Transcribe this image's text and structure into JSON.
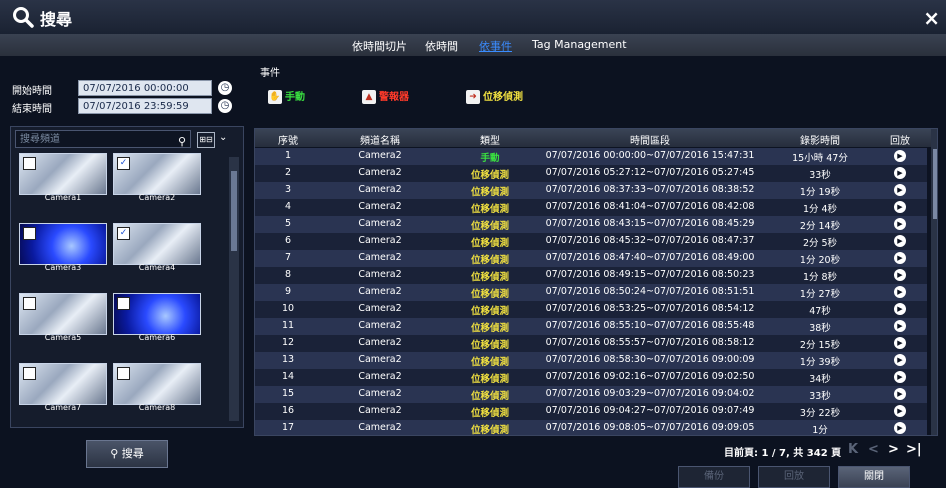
{
  "window": {
    "title": "搜尋",
    "close_glyph": "×"
  },
  "tabs": [
    {
      "label": "依時間切片",
      "active": false
    },
    {
      "label": "依時間",
      "active": false
    },
    {
      "label": "依事件",
      "active": true
    },
    {
      "label": "Tag Management",
      "active": false
    }
  ],
  "time": {
    "start_label": "開始時間",
    "start_value": "07/07/2016 00:00:00",
    "end_label": "結束時間",
    "end_value": "07/07/2016 23:59:59"
  },
  "channels": {
    "search_placeholder": "搜尋頻道",
    "view_toggle": "⊞⊟",
    "items": [
      {
        "name": "Camera1",
        "checked": false,
        "style": "light"
      },
      {
        "name": "Camera2",
        "checked": true,
        "style": "light"
      },
      {
        "name": "Camera3",
        "checked": false,
        "style": "blue"
      },
      {
        "name": "Camera4",
        "checked": true,
        "style": "light"
      },
      {
        "name": "Camera5",
        "checked": false,
        "style": "light"
      },
      {
        "name": "Camera6",
        "checked": false,
        "style": "blue"
      },
      {
        "name": "Camera7",
        "checked": false,
        "style": "light"
      },
      {
        "name": "Camera8",
        "checked": false,
        "style": "light"
      }
    ]
  },
  "search_button": "搜尋",
  "events": {
    "label": "事件",
    "types": [
      {
        "label": "手動",
        "color": "#3ae040"
      },
      {
        "label": "警報器",
        "color": "#ff3a2a"
      },
      {
        "label": "位移偵測",
        "color": "#f0e040"
      }
    ]
  },
  "table": {
    "headers": [
      "序號",
      "頻道名稱",
      "類型",
      "時間區段",
      "錄影時間",
      "回放"
    ],
    "rows": [
      {
        "no": "1",
        "ch": "Camera2",
        "type": "手動",
        "kind": "manual",
        "range": "07/07/2016 00:00:00~07/07/2016 15:47:31",
        "dur": "15小時 47分"
      },
      {
        "no": "2",
        "ch": "Camera2",
        "type": "位移偵測",
        "kind": "motion",
        "range": "07/07/2016 05:27:12~07/07/2016 05:27:45",
        "dur": "33秒"
      },
      {
        "no": "3",
        "ch": "Camera2",
        "type": "位移偵測",
        "kind": "motion",
        "range": "07/07/2016 08:37:33~07/07/2016 08:38:52",
        "dur": "1分 19秒"
      },
      {
        "no": "4",
        "ch": "Camera2",
        "type": "位移偵測",
        "kind": "motion",
        "range": "07/07/2016 08:41:04~07/07/2016 08:42:08",
        "dur": "1分 4秒"
      },
      {
        "no": "5",
        "ch": "Camera2",
        "type": "位移偵測",
        "kind": "motion",
        "range": "07/07/2016 08:43:15~07/07/2016 08:45:29",
        "dur": "2分 14秒"
      },
      {
        "no": "6",
        "ch": "Camera2",
        "type": "位移偵測",
        "kind": "motion",
        "range": "07/07/2016 08:45:32~07/07/2016 08:47:37",
        "dur": "2分 5秒"
      },
      {
        "no": "7",
        "ch": "Camera2",
        "type": "位移偵測",
        "kind": "motion",
        "range": "07/07/2016 08:47:40~07/07/2016 08:49:00",
        "dur": "1分 20秒"
      },
      {
        "no": "8",
        "ch": "Camera2",
        "type": "位移偵測",
        "kind": "motion",
        "range": "07/07/2016 08:49:15~07/07/2016 08:50:23",
        "dur": "1分 8秒"
      },
      {
        "no": "9",
        "ch": "Camera2",
        "type": "位移偵測",
        "kind": "motion",
        "range": "07/07/2016 08:50:24~07/07/2016 08:51:51",
        "dur": "1分 27秒"
      },
      {
        "no": "10",
        "ch": "Camera2",
        "type": "位移偵測",
        "kind": "motion",
        "range": "07/07/2016 08:53:25~07/07/2016 08:54:12",
        "dur": "47秒"
      },
      {
        "no": "11",
        "ch": "Camera2",
        "type": "位移偵測",
        "kind": "motion",
        "range": "07/07/2016 08:55:10~07/07/2016 08:55:48",
        "dur": "38秒"
      },
      {
        "no": "12",
        "ch": "Camera2",
        "type": "位移偵測",
        "kind": "motion",
        "range": "07/07/2016 08:55:57~07/07/2016 08:58:12",
        "dur": "2分 15秒"
      },
      {
        "no": "13",
        "ch": "Camera2",
        "type": "位移偵測",
        "kind": "motion",
        "range": "07/07/2016 08:58:30~07/07/2016 09:00:09",
        "dur": "1分 39秒"
      },
      {
        "no": "14",
        "ch": "Camera2",
        "type": "位移偵測",
        "kind": "motion",
        "range": "07/07/2016 09:02:16~07/07/2016 09:02:50",
        "dur": "34秒"
      },
      {
        "no": "15",
        "ch": "Camera2",
        "type": "位移偵測",
        "kind": "motion",
        "range": "07/07/2016 09:03:29~07/07/2016 09:04:02",
        "dur": "33秒"
      },
      {
        "no": "16",
        "ch": "Camera2",
        "type": "位移偵測",
        "kind": "motion",
        "range": "07/07/2016 09:04:27~07/07/2016 09:07:49",
        "dur": "3分 22秒"
      },
      {
        "no": "17",
        "ch": "Camera2",
        "type": "位移偵測",
        "kind": "motion",
        "range": "07/07/2016 09:08:05~07/07/2016 09:09:05",
        "dur": "1分"
      }
    ]
  },
  "pagination": {
    "info": "目前頁: 1 / 7, 共 342 頁",
    "first": "K",
    "prev": "<",
    "next": ">",
    "last": ">|"
  },
  "footer": {
    "backup": "備份",
    "playback": "回放",
    "close": "關閉"
  }
}
